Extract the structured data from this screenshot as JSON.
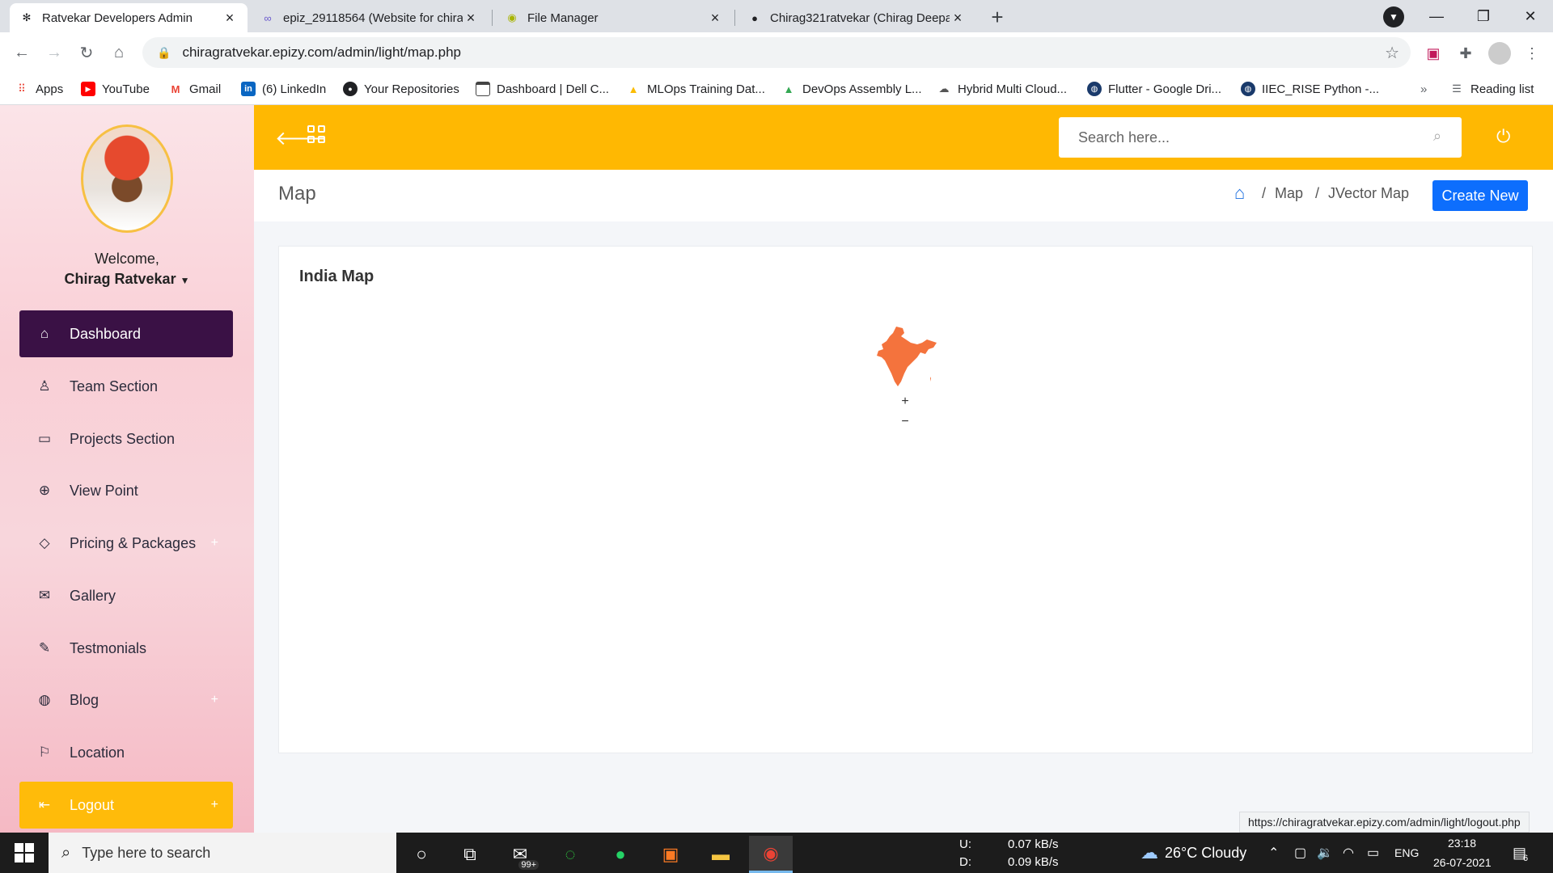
{
  "browser": {
    "tabs": [
      {
        "title": "Ratvekar Developers Admin",
        "icon": "gear-icon",
        "active": true
      },
      {
        "title": "epiz_29118564 (Website for chira",
        "icon": "infinity-icon",
        "active": false
      },
      {
        "title": "File Manager",
        "icon": "file-manager-icon",
        "active": false
      },
      {
        "title": "Chirag321ratvekar (Chirag Deepa",
        "icon": "github-icon",
        "active": false
      }
    ],
    "url": "chiragratvekar.epizy.com/admin/light/map.php",
    "bookmarks": [
      {
        "label": "Apps",
        "icon": "apps-grid-icon",
        "color": "#ea4335"
      },
      {
        "label": "YouTube",
        "icon": "youtube-icon",
        "color": "#ff0000"
      },
      {
        "label": "Gmail",
        "icon": "gmail-icon",
        "color": "#ea4335"
      },
      {
        "label": "(6) LinkedIn",
        "icon": "linkedin-icon",
        "color": "#0a66c2"
      },
      {
        "label": "Your Repositories",
        "icon": "github-icon",
        "color": "#202124"
      },
      {
        "label": "Dashboard | Dell C...",
        "icon": "page-icon",
        "color": "#444444"
      },
      {
        "label": "MLOps Training Dat...",
        "icon": "drive-icon",
        "color": "#fbbc04"
      },
      {
        "label": "DevOps Assembly L...",
        "icon": "drive-icon",
        "color": "#34a853"
      },
      {
        "label": "Hybrid Multi Cloud...",
        "icon": "cloud-icon",
        "color": "#555555"
      },
      {
        "label": "Flutter - Google Dri...",
        "icon": "globe-icon",
        "color": "#1a3a6b"
      },
      {
        "label": "IIEC_RISE Python -...",
        "icon": "globe-icon",
        "color": "#1a3a6b"
      }
    ],
    "overflow": "»",
    "reading_list": "Reading list"
  },
  "sidebar": {
    "welcome": "Welcome,",
    "username": "Chirag Ratvekar",
    "items": [
      {
        "label": "Dashboard",
        "icon": "home-icon",
        "active": true
      },
      {
        "label": "Team Section",
        "icon": "user-icon"
      },
      {
        "label": "Projects Section",
        "icon": "monitor-icon"
      },
      {
        "label": "View Point",
        "icon": "crosshair-icon"
      },
      {
        "label": "Pricing & Packages",
        "icon": "diamond-icon",
        "plus": "+"
      },
      {
        "label": "Gallery",
        "icon": "mail-icon"
      },
      {
        "label": "Testmonials",
        "icon": "pencil-icon"
      },
      {
        "label": "Blog",
        "icon": "globe-icon",
        "plus": "+"
      },
      {
        "label": "Location",
        "icon": "signpost-icon"
      },
      {
        "label": "Logout",
        "icon": "logout-icon",
        "plus": "+"
      }
    ]
  },
  "header": {
    "search_placeholder": "Search here..."
  },
  "page": {
    "title": "Map",
    "breadcrumb": [
      "Map",
      "JVector Map"
    ],
    "create_button": "Create New",
    "card_title": "India Map",
    "zoom_in": "+",
    "zoom_out": "−",
    "map_color": "#f4733d"
  },
  "status_url": "https://chiragratvekar.epizy.com/admin/light/logout.php",
  "taskbar": {
    "search_placeholder": "Type here to search",
    "mail_badge": "99+",
    "net_up_label": "U:",
    "net_up": "0.07 kB/s",
    "net_down_label": "D:",
    "net_down": "0.09 kB/s",
    "weather": "26°C  Cloudy",
    "lang": "ENG",
    "time": "23:18",
    "date": "26-07-2021",
    "notifications": "6"
  },
  "colors": {
    "accent": "#ffb802",
    "sidebar_active": "#3a1145",
    "primary": "#0d6efd"
  }
}
